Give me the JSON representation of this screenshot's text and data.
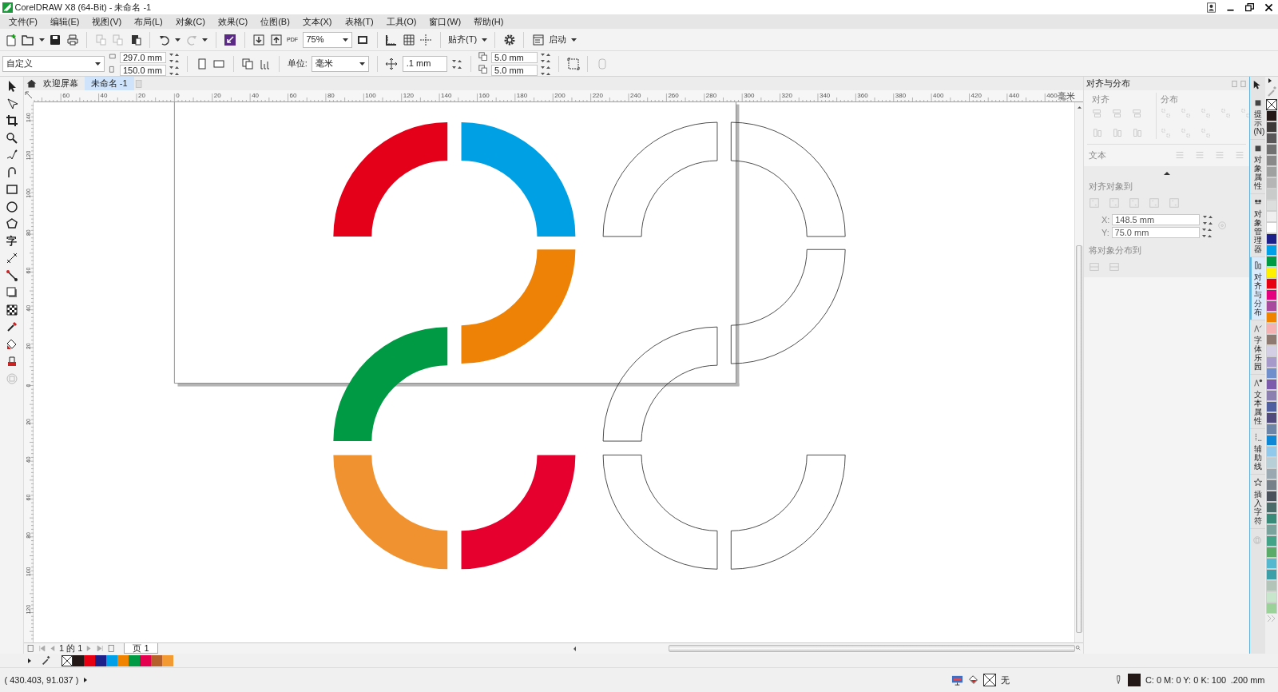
{
  "window": {
    "title": "CorelDRAW X8 (64-Bit) - 未命名 -1"
  },
  "menu": [
    "文件(F)",
    "编辑(E)",
    "视图(V)",
    "布局(L)",
    "对象(C)",
    "效果(C)",
    "位图(B)",
    "文本(X)",
    "表格(T)",
    "工具(O)",
    "窗口(W)",
    "帮助(H)"
  ],
  "standard_toolbar": {
    "pdf_label": "PDF",
    "zoom": "75%",
    "snap": "贴齐(T)",
    "launch": "启动"
  },
  "property_bar": {
    "page_preset": "自定义",
    "width": "297.0 mm",
    "height": "150.0 mm",
    "units_label": "单位:",
    "units": "毫米",
    "nudge": ".1 mm",
    "duplicate_x": "5.0 mm",
    "duplicate_y": "5.0 mm"
  },
  "toolbox": {
    "text_tool": "字"
  },
  "document_tabs": [
    {
      "label": "欢迎屏幕",
      "selected": false
    },
    {
      "label": "未命名 -1",
      "selected": true
    }
  ],
  "top_ruler": {
    "labels": [
      "60",
      "40",
      "20",
      "0",
      "20",
      "40",
      "60",
      "80",
      "100",
      "120",
      "140",
      "160",
      "180",
      "200",
      "220",
      "240",
      "260",
      "280",
      "300",
      "320",
      "340",
      "360",
      "380",
      "400",
      "420",
      "440",
      "460"
    ],
    "unit": "毫米"
  },
  "left_ruler": {
    "labels": [
      "140",
      "120",
      "100",
      "80",
      "60",
      "40",
      "20",
      "0",
      "20",
      "40",
      "60",
      "80",
      "100",
      "120"
    ]
  },
  "canvas": {
    "shapes": [
      {
        "kind": "filled",
        "color": "#e50019"
      },
      {
        "kind": "filled",
        "color": "#00a0e4"
      },
      {
        "kind": "filled",
        "color": "#ee8207"
      },
      {
        "kind": "filled",
        "color": "#009a44"
      },
      {
        "kind": "filled",
        "color": "#f19230"
      },
      {
        "kind": "filled",
        "color": "#e5002d"
      },
      {
        "kind": "outline"
      },
      {
        "kind": "outline"
      },
      {
        "kind": "outline"
      },
      {
        "kind": "outline"
      },
      {
        "kind": "outline"
      },
      {
        "kind": "outline"
      }
    ]
  },
  "page_navigator": {
    "counter": "1 的 1",
    "page_tab": "页 1"
  },
  "docker": {
    "title": "对齐与分布",
    "align_label": "对齐",
    "distribute_label": "分布",
    "text_label": "文本",
    "align_to_label": "对齐对象到",
    "x_label": "X:",
    "x": "148.5 mm",
    "y_label": "Y:",
    "y": "75.0 mm",
    "distribute_to_label": "将对象分布到"
  },
  "docker_tabs": [
    {
      "label": "提示(N)",
      "selected": false
    },
    {
      "label": "对象属性",
      "selected": false
    },
    {
      "label": "对象管理器",
      "selected": false
    },
    {
      "label": "对齐与分布",
      "selected": true
    },
    {
      "label": "字体乐园",
      "selected": false
    },
    {
      "label": "文本属性",
      "selected": false
    },
    {
      "label": "辅助线",
      "selected": false
    },
    {
      "label": "插入字符",
      "selected": false
    }
  ],
  "color_palette": [
    {
      "kind": "none"
    },
    {
      "kind": "swatch",
      "color": "#231815"
    },
    {
      "kind": "swatch",
      "color": "#3e3a39"
    },
    {
      "kind": "swatch",
      "color": "#595757"
    },
    {
      "kind": "swatch",
      "color": "#727171"
    },
    {
      "kind": "swatch",
      "color": "#898989"
    },
    {
      "kind": "swatch",
      "color": "#9fa0a0"
    },
    {
      "kind": "swatch",
      "color": "#b5b5b6"
    },
    {
      "kind": "swatch",
      "color": "#c9caca"
    },
    {
      "kind": "swatch",
      "color": "#dcdddd"
    },
    {
      "kind": "swatch",
      "color": "#efefef"
    },
    {
      "kind": "swatch",
      "color": "#ffffff"
    },
    {
      "kind": "swatch",
      "color": "#1d2088"
    },
    {
      "kind": "swatch",
      "color": "#00a0e9"
    },
    {
      "kind": "swatch",
      "color": "#009944"
    },
    {
      "kind": "swatch",
      "color": "#fff100"
    },
    {
      "kind": "swatch",
      "color": "#e60012"
    },
    {
      "kind": "swatch",
      "color": "#e4007f"
    },
    {
      "kind": "swatch",
      "color": "#a84a9e"
    },
    {
      "kind": "swatch",
      "color": "#f08300"
    },
    {
      "kind": "swatch",
      "color": "#f5b2b2"
    },
    {
      "kind": "swatch",
      "color": "#8f7a72"
    },
    {
      "kind": "swatch",
      "color": "#d5cfe6"
    },
    {
      "kind": "swatch",
      "color": "#a59aca"
    },
    {
      "kind": "swatch",
      "color": "#6f8fcc"
    },
    {
      "kind": "swatch",
      "color": "#7d5bac"
    },
    {
      "kind": "swatch",
      "color": "#8b80b0"
    },
    {
      "kind": "swatch",
      "color": "#4f5f9f"
    },
    {
      "kind": "swatch",
      "color": "#514a7d"
    },
    {
      "kind": "swatch",
      "color": "#6d86a8"
    },
    {
      "kind": "swatch",
      "color": "#0e88d6"
    },
    {
      "kind": "swatch",
      "color": "#90c9ec"
    },
    {
      "kind": "swatch",
      "color": "#b9cfd8"
    },
    {
      "kind": "swatch",
      "color": "#9aa8b1"
    },
    {
      "kind": "swatch",
      "color": "#768089"
    },
    {
      "kind": "swatch",
      "color": "#4a515a"
    },
    {
      "kind": "swatch",
      "color": "#4b6a6a"
    },
    {
      "kind": "swatch",
      "color": "#3a8a7a"
    },
    {
      "kind": "swatch",
      "color": "#7aa39e"
    },
    {
      "kind": "swatch",
      "color": "#42a388"
    },
    {
      "kind": "swatch",
      "color": "#5aaa6a"
    },
    {
      "kind": "swatch",
      "color": "#56b8cf"
    },
    {
      "kind": "swatch",
      "color": "#3da0a8"
    },
    {
      "kind": "swatch",
      "color": "#b2c4b8"
    },
    {
      "kind": "swatch",
      "color": "#c8e6cc"
    },
    {
      "kind": "swatch",
      "color": "#9ad29a"
    }
  ],
  "document_palette": [
    {
      "kind": "none"
    },
    {
      "kind": "swatch",
      "color": "#231815"
    },
    {
      "kind": "swatch",
      "color": "#e60012"
    },
    {
      "kind": "swatch",
      "color": "#1d2088"
    },
    {
      "kind": "swatch",
      "color": "#00a0e9"
    },
    {
      "kind": "swatch",
      "color": "#f08300"
    },
    {
      "kind": "swatch",
      "color": "#009944"
    },
    {
      "kind": "swatch",
      "color": "#e5004f"
    },
    {
      "kind": "swatch",
      "color": "#b5602b"
    },
    {
      "kind": "swatch",
      "color": "#f39a32"
    }
  ],
  "status_bar": {
    "coordinates": "( 430.403, 91.037 )",
    "fill": "无",
    "outline_swatch": {
      "color": "#231815"
    },
    "outline": "C: 0 M: 0 Y: 0 K: 100",
    "width": ".200 mm"
  }
}
